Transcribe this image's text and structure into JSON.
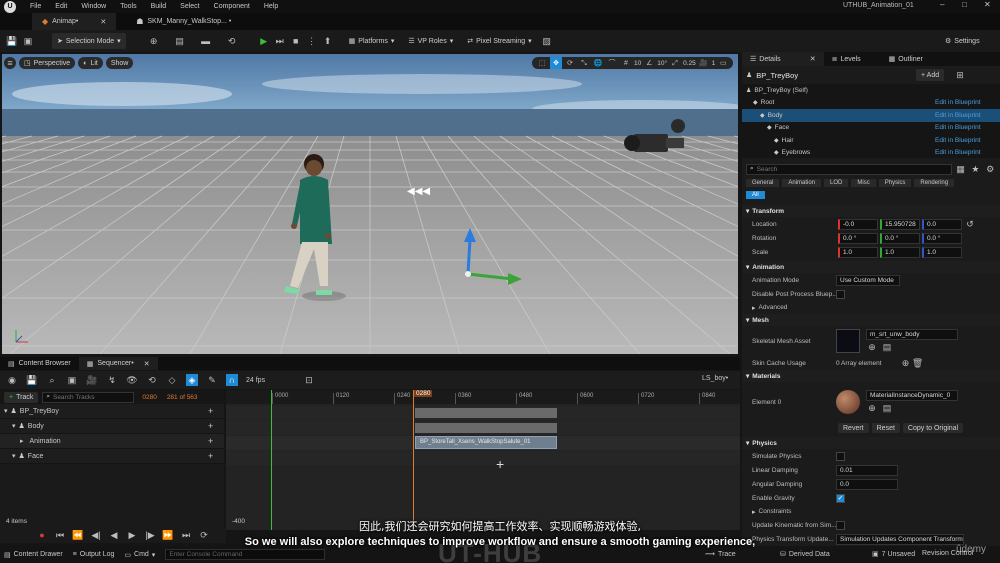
{
  "menu": {
    "items": [
      "File",
      "Edit",
      "Window",
      "Tools",
      "Build",
      "Select",
      "Component",
      "Help"
    ],
    "project": "UTHUB_Animation_01"
  },
  "tabs": [
    {
      "label": "Animap•"
    },
    {
      "label": "SKM_Manny_WalkStop... •"
    }
  ],
  "toolbar": {
    "selection_mode": "Selection Mode",
    "platforms": "Platforms",
    "vp_roles": "VP Roles",
    "pixel_streaming": "Pixel Streaming",
    "settings": "Settings"
  },
  "viewport": {
    "perspective": "Perspective",
    "lit": "Lit",
    "show": "Show",
    "grid_snap": "10",
    "rot_snap": "10°",
    "scale_snap": "0.25",
    "cam_speed": "1"
  },
  "bottom_tabs": {
    "content_browser": "Content Browser",
    "sequencer": "Sequencer•"
  },
  "sequencer": {
    "fps": "24 fps",
    "seq_name": "LS_boy•",
    "track_button": "Track",
    "search_placeholder": "Search Tracks",
    "current_frame": "0280",
    "frame_of": "281 of 563",
    "ticks": [
      "0000",
      "0120",
      "0240",
      "0360",
      "0480",
      "0600",
      "0720",
      "0840"
    ],
    "playhead": "0280",
    "range_start": "-400",
    "tracks": [
      {
        "label": "BP_TreyBoy",
        "level": 0
      },
      {
        "label": "Body",
        "level": 1
      },
      {
        "label": "Animation",
        "level": 2
      },
      {
        "label": "Face",
        "level": 1
      }
    ],
    "clip_label": "BP_StoreTall_Xsens_WalkStopSalute_01",
    "items_count": "4 items"
  },
  "statusbar": {
    "content_drawer": "Content Drawer",
    "output_log": "Output Log",
    "cmd": "Cmd",
    "console_placeholder": "Enter Console Command",
    "trace": "Trace",
    "derived_data": "Derived Data",
    "unsaved": "7 Unsaved",
    "revision_control": "Revision Control"
  },
  "details": {
    "tab_details": "Details",
    "tab_levels": "Levels",
    "tab_outliner": "Outliner",
    "actor_name": "BP_TreyBoy",
    "add_button": "+ Add",
    "components": [
      {
        "label": "BP_TreyBoy (Self)",
        "level": 0,
        "edit": ""
      },
      {
        "label": "Root",
        "level": 1,
        "edit": "Edit in Blueprint"
      },
      {
        "label": "Body",
        "level": 2,
        "edit": "Edit in Blueprint"
      },
      {
        "label": "Face",
        "level": 3,
        "edit": "Edit in Blueprint"
      },
      {
        "label": "Hair",
        "level": 4,
        "edit": "Edit in Blueprint"
      },
      {
        "label": "Eyebrows",
        "level": 4,
        "edit": "Edit in Blueprint"
      }
    ],
    "search_placeholder": "Search",
    "filters": [
      "General",
      "Animation",
      "LOD",
      "Misc",
      "Physics",
      "Rendering"
    ],
    "filter_all": "All",
    "transform": {
      "header": "Transform",
      "location_label": "Location",
      "location": [
        "-0.0",
        "15.950728",
        "0.0"
      ],
      "rotation_label": "Rotation",
      "rotation": [
        "0.0 °",
        "0.0 °",
        "0.0 °"
      ],
      "scale_label": "Scale",
      "scale": [
        "1.0",
        "1.0",
        "1.0"
      ]
    },
    "animation": {
      "header": "Animation",
      "mode_label": "Animation Mode",
      "mode_value": "Use Custom Mode",
      "disable_pp_label": "Disable Post Process Bluep...",
      "advanced": "Advanced"
    },
    "mesh": {
      "header": "Mesh",
      "skeletal_label": "Skeletal Mesh Asset",
      "skeletal_value": "m_srt_unw_body",
      "skin_cache_label": "Skin Cache Usage",
      "skin_cache_value": "0 Array element"
    },
    "materials": {
      "header": "Materials",
      "element_label": "Element 0",
      "element_value": "MaterialInstanceDynamic_0",
      "revert": "Revert",
      "reset": "Reset",
      "copy": "Copy to Original"
    },
    "physics": {
      "header": "Physics",
      "simulate_label": "Simulate Physics",
      "linear_label": "Linear Damping",
      "linear_value": "0.01",
      "angular_label": "Angular Damping",
      "angular_value": "0.0",
      "gravity_label": "Enable Gravity",
      "constraints": "Constraints",
      "kinematic_label": "Update Kinematic from Sim...",
      "transform_update_label": "Physics Transform Update...",
      "transform_update_value": "Simulation Updates Component Transform"
    }
  },
  "subtitles": {
    "chinese": "因此,我们还会研究如何提高工作效率、实现顺畅游戏体验,",
    "english": "So we will also explore techniques to improve workflow and ensure a smooth gaming experience,"
  },
  "watermark": "UT-HUB",
  "udemy": "ûdemy",
  "colors": {
    "accent_blue": "#1f8bd6",
    "selection": "#1c4f78",
    "play_green": "#3cbf3c",
    "record_red": "#d83a3a",
    "playhead_orange": "#e07a2f"
  }
}
